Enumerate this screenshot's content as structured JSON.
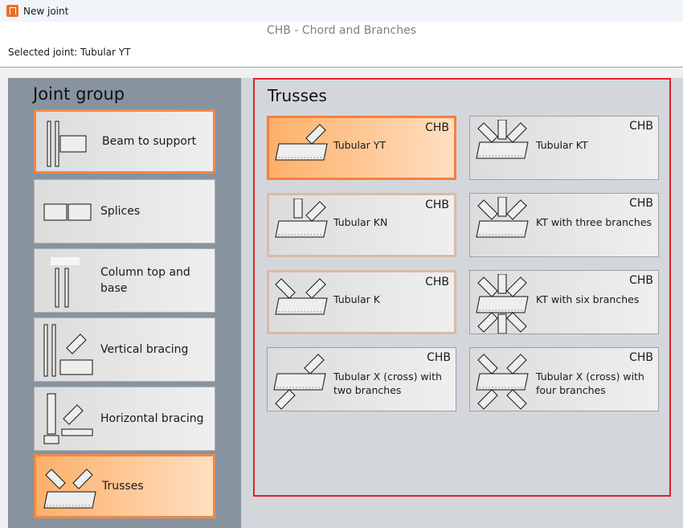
{
  "window": {
    "title": "New joint"
  },
  "header": {
    "subtitle": "CHB - Chord and Branches",
    "selected_joint": "Selected joint: Tubular YT"
  },
  "joint_group": {
    "title": "Joint group",
    "items": [
      {
        "label": "Beam to support",
        "state": "outlined"
      },
      {
        "label": "Splices",
        "state": "normal"
      },
      {
        "label": "Column top and base",
        "state": "normal"
      },
      {
        "label": "Vertical bracing",
        "state": "normal"
      },
      {
        "label": "Horizontal bracing",
        "state": "normal"
      },
      {
        "label": "Trusses",
        "state": "selected"
      }
    ]
  },
  "trusses": {
    "title": "Trusses",
    "items": [
      {
        "label": "Tubular YT",
        "tag": "CHB",
        "state": "selected",
        "icon": "yt"
      },
      {
        "label": "Tubular KT",
        "tag": "CHB",
        "state": "normal",
        "icon": "kt"
      },
      {
        "label": "Tubular KN",
        "tag": "CHB",
        "state": "hover",
        "icon": "kn"
      },
      {
        "label": "KT with three branches",
        "tag": "CHB",
        "state": "normal",
        "icon": "kt3"
      },
      {
        "label": "Tubular K",
        "tag": "CHB",
        "state": "hover",
        "icon": "k"
      },
      {
        "label": "KT with six branches",
        "tag": "CHB",
        "state": "normal",
        "icon": "kt6"
      },
      {
        "label": "Tubular X (cross) with two branches",
        "tag": "CHB",
        "state": "normal",
        "icon": "x2"
      },
      {
        "label": "Tubular X (cross) with four branches",
        "tag": "CHB",
        "state": "normal",
        "icon": "x4"
      }
    ]
  }
}
